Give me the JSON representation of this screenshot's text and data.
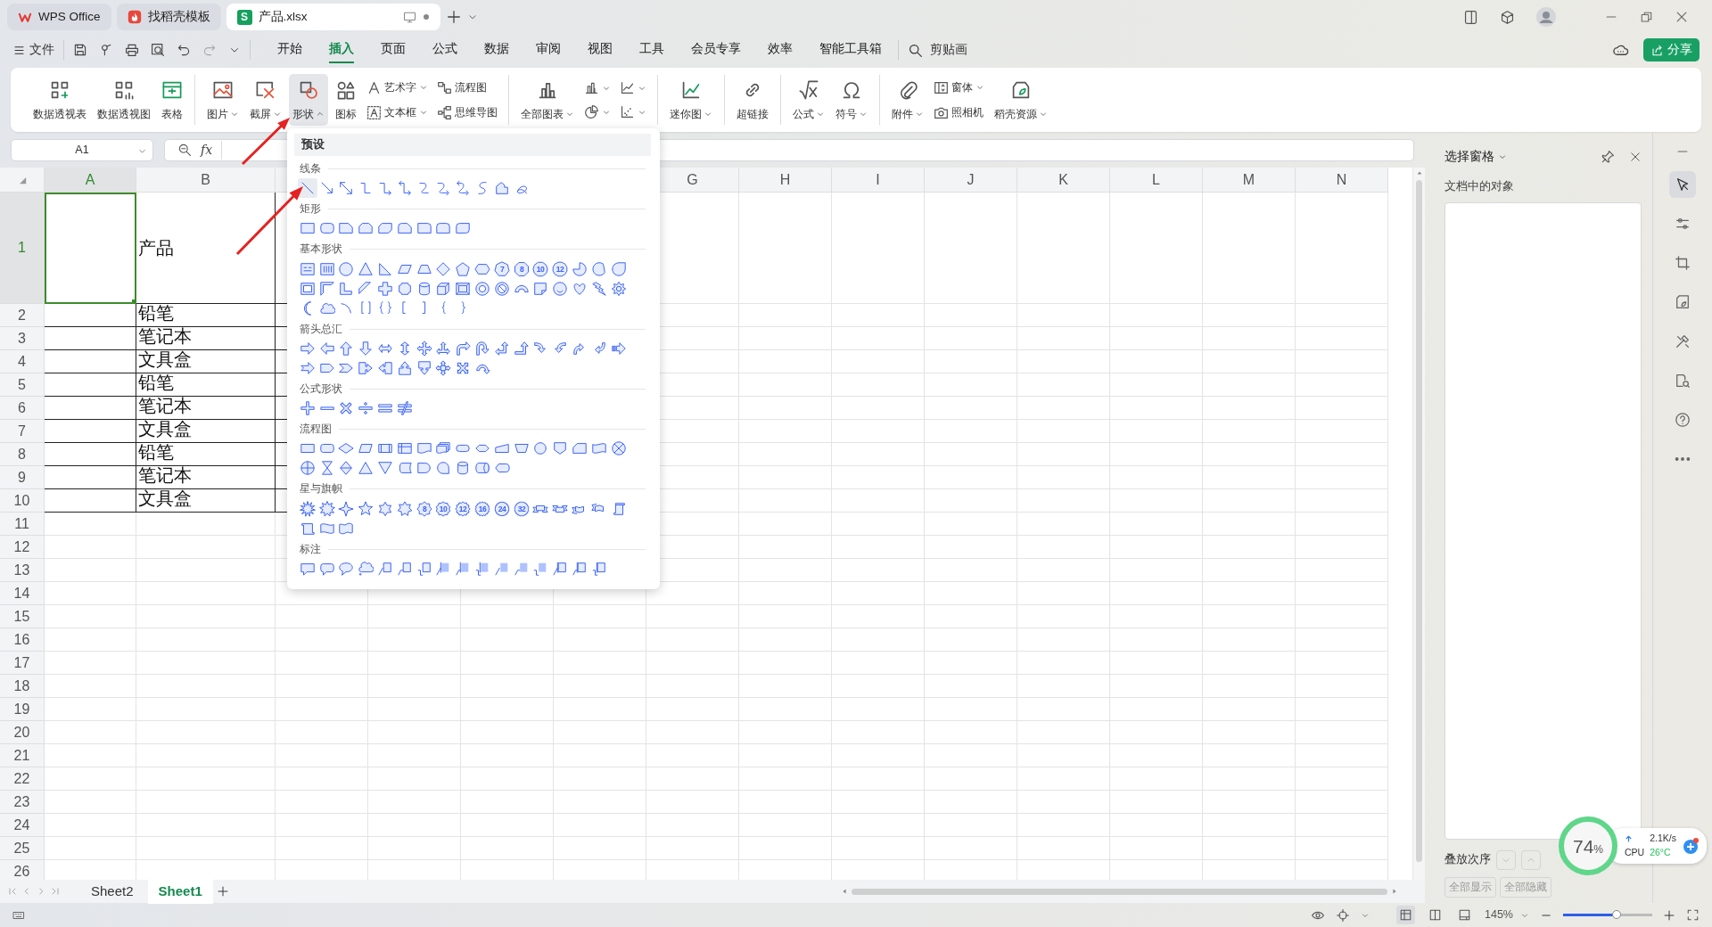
{
  "title_tabs": [
    {
      "kind": "wps",
      "label": "WPS Office",
      "selected": false
    },
    {
      "kind": "docer",
      "label": "找稻壳模板",
      "selected": false
    },
    {
      "kind": "sheet",
      "icon_letter": "S",
      "label": "产品.xlsx",
      "selected": true
    }
  ],
  "menu": {
    "file": "文件",
    "tabs": [
      {
        "label": "开始",
        "selected": false
      },
      {
        "label": "插入",
        "selected": true
      },
      {
        "label": "页面",
        "selected": false
      },
      {
        "label": "公式",
        "selected": false
      },
      {
        "label": "数据",
        "selected": false
      },
      {
        "label": "审阅",
        "selected": false
      },
      {
        "label": "视图",
        "selected": false
      },
      {
        "label": "工具",
        "selected": false
      },
      {
        "label": "会员专享",
        "selected": false
      },
      {
        "label": "效率",
        "selected": false
      },
      {
        "label": "智能工具箱",
        "selected": false
      }
    ],
    "search": "剪贴画",
    "share": "分享"
  },
  "ribbon": [
    {
      "items": [
        {
          "kind": "large",
          "label": "数据透视表",
          "dropdown": false,
          "expanded": false
        },
        {
          "kind": "large",
          "label": "数据透视图",
          "dropdown": false,
          "expanded": false
        },
        {
          "kind": "large",
          "label": "表格",
          "dropdown": false,
          "expanded": false
        }
      ]
    },
    {
      "items": [
        {
          "kind": "large",
          "label": "图片",
          "dropdown": true,
          "expanded": false
        },
        {
          "kind": "large",
          "label": "截屏",
          "dropdown": true,
          "expanded": false
        },
        {
          "kind": "large",
          "label": "形状",
          "dropdown": true,
          "expanded": true
        },
        {
          "kind": "large",
          "label": "图标",
          "dropdown": false,
          "expanded": false
        },
        {
          "kind": "stack",
          "items": [
            {
              "label": "艺术字",
              "dropdown": true,
              "expanded": false
            },
            {
              "label": "文本框",
              "dropdown": true,
              "expanded": false
            }
          ]
        },
        {
          "kind": "stack",
          "items": [
            {
              "label": "流程图",
              "dropdown": false,
              "expanded": false
            },
            {
              "label": "思维导图",
              "dropdown": false,
              "expanded": false
            }
          ]
        }
      ]
    },
    {
      "items": [
        {
          "kind": "large",
          "label": "全部图表",
          "dropdown": true,
          "expanded": false
        },
        {
          "kind": "stack",
          "items": [
            {
              "dropdown": true,
              "expanded": false
            },
            {
              "dropdown": true,
              "expanded": false
            }
          ]
        },
        {
          "kind": "stack",
          "items": [
            {
              "dropdown": true,
              "expanded": false
            },
            {
              "dropdown": true,
              "expanded": false
            }
          ]
        }
      ]
    },
    {
      "items": [
        {
          "kind": "large",
          "label": "迷你图",
          "dropdown": true,
          "expanded": false
        }
      ]
    },
    {
      "items": [
        {
          "kind": "large",
          "label": "超链接",
          "dropdown": false,
          "expanded": false
        }
      ]
    },
    {
      "items": [
        {
          "kind": "large",
          "label": "公式",
          "dropdown": true,
          "expanded": false
        },
        {
          "kind": "large",
          "label": "符号",
          "dropdown": true,
          "expanded": false
        }
      ]
    },
    {
      "items": [
        {
          "kind": "large",
          "label": "附件",
          "dropdown": true,
          "expanded": false
        },
        {
          "kind": "stack",
          "items": [
            {
              "label": "窗体",
              "dropdown": true,
              "expanded": false
            },
            {
              "label": "照相机",
              "dropdown": false,
              "expanded": false
            }
          ]
        },
        {
          "kind": "large",
          "label": "稻壳资源",
          "dropdown": true,
          "expanded": false
        }
      ]
    }
  ],
  "formula_bar": {
    "name_box": "A1",
    "fx": "fx"
  },
  "sheet": {
    "columns": [
      {
        "label": "A",
        "selected": true
      },
      {
        "label": "B",
        "selected": false
      },
      {
        "selected": false
      },
      {},
      {},
      {},
      {
        "label": "G",
        "selected": false
      },
      {
        "label": "H",
        "selected": false
      },
      {
        "label": "I",
        "selected": false
      },
      {
        "label": "J",
        "selected": false
      },
      {
        "label": "K",
        "selected": false
      },
      {
        "label": "L",
        "selected": false
      },
      {
        "label": "M",
        "selected": false
      },
      {
        "label": "N",
        "selected": false
      }
    ],
    "rows": [
      {
        "label": "1",
        "selected": true,
        "bordered": true,
        "b": "产品"
      },
      {
        "label": "2",
        "selected": false,
        "bordered": true,
        "b": "铅笔"
      },
      {
        "label": "3",
        "selected": false,
        "bordered": true,
        "b": "笔记本"
      },
      {
        "label": "4",
        "selected": false,
        "bordered": true,
        "b": "文具盒"
      },
      {
        "label": "5",
        "selected": false,
        "bordered": true,
        "b": "铅笔"
      },
      {
        "label": "6",
        "selected": false,
        "bordered": true,
        "b": "笔记本"
      },
      {
        "label": "7",
        "selected": false,
        "bordered": true,
        "b": "文具盒"
      },
      {
        "label": "8",
        "selected": false,
        "bordered": true,
        "b": "铅笔"
      },
      {
        "label": "9",
        "selected": false,
        "bordered": true,
        "b": "笔记本"
      },
      {
        "label": "10",
        "selected": false,
        "bordered": true,
        "b": "文具盒"
      },
      {
        "label": "11",
        "selected": false,
        "bordered": false
      },
      {
        "label": "12",
        "selected": false,
        "bordered": false
      },
      {
        "label": "13",
        "selected": false,
        "bordered": false
      },
      {
        "label": "14",
        "selected": false,
        "bordered": false
      },
      {
        "label": "15",
        "selected": false,
        "bordered": false
      },
      {
        "label": "16",
        "selected": false,
        "bordered": false
      },
      {
        "label": "17",
        "selected": false,
        "bordered": false
      },
      {
        "label": "18",
        "selected": false,
        "bordered": false
      },
      {
        "label": "19",
        "selected": false,
        "bordered": false
      },
      {
        "label": "20",
        "selected": false,
        "bordered": false
      },
      {
        "label": "21",
        "selected": false,
        "bordered": false
      },
      {
        "label": "22",
        "selected": false,
        "bordered": false
      },
      {
        "label": "23",
        "selected": false,
        "bordered": false
      },
      {
        "label": "24",
        "selected": false,
        "bordered": false
      },
      {
        "label": "25",
        "selected": false,
        "bordered": false
      },
      {
        "label": "26",
        "selected": false,
        "bordered": false
      }
    ]
  },
  "shape_menu": {
    "title": "预设",
    "sections": [
      {
        "title": "线条",
        "items": [
          {
            "kind": "line",
            "selected": true
          },
          {
            "kind": "arrow",
            "selected": false
          },
          {
            "kind": "doublearrow",
            "selected": false
          },
          {
            "kind": "elbow",
            "selected": false
          },
          {
            "kind": "elbowarrow",
            "selected": false
          },
          {
            "kind": "elbowdouble",
            "selected": false
          },
          {
            "kind": "curve",
            "selected": false
          },
          {
            "kind": "curvearrow",
            "selected": false
          },
          {
            "kind": "curvedouble",
            "selected": false
          },
          {
            "kind": "scurve",
            "selected": false
          },
          {
            "kind": "freeform",
            "selected": false
          },
          {
            "kind": "scribble",
            "selected": false
          }
        ]
      },
      {
        "title": "矩形",
        "items": [
          {
            "kind": "rect",
            "selected": false
          },
          {
            "kind": "roundrect",
            "selected": false
          },
          {
            "kind": "snip1",
            "selected": false
          },
          {
            "kind": "snip2",
            "selected": false
          },
          {
            "kind": "snipdiag",
            "selected": false
          },
          {
            "kind": "sniproundrect",
            "selected": false
          },
          {
            "kind": "round1",
            "selected": false
          },
          {
            "kind": "round2",
            "selected": false
          },
          {
            "kind": "rounddiag",
            "selected": false
          }
        ]
      },
      {
        "title": "基本形状",
        "items": [
          {
            "kind": "textbox",
            "selected": false
          },
          {
            "kind": "vtextbox",
            "selected": false
          },
          {
            "kind": "ellipse",
            "selected": false
          },
          {
            "kind": "triangle",
            "selected": false
          },
          {
            "kind": "righttriangle",
            "selected": false
          },
          {
            "kind": "parallelogram",
            "selected": false
          },
          {
            "kind": "trapezoid",
            "selected": false
          },
          {
            "kind": "diamond",
            "selected": false
          },
          {
            "kind": "pentagon",
            "selected": false
          },
          {
            "kind": "hexagon",
            "selected": false
          },
          {
            "kind": "heptagon",
            "label": "7",
            "selected": false
          },
          {
            "kind": "octagon",
            "label": "8",
            "selected": false
          },
          {
            "kind": "decagon",
            "label": "10",
            "selected": false
          },
          {
            "kind": "dodecagon",
            "label": "12",
            "selected": false
          },
          {
            "kind": "pie",
            "selected": false
          },
          {
            "kind": "chord",
            "selected": false
          },
          {
            "kind": "teardrop",
            "selected": false
          },
          {
            "kind": "frame",
            "selected": false
          },
          {
            "kind": "halfframe",
            "selected": false
          },
          {
            "kind": "lshape",
            "selected": false
          },
          {
            "kind": "diagstripe",
            "selected": false
          },
          {
            "kind": "cross",
            "selected": false
          },
          {
            "kind": "plaque",
            "selected": false
          },
          {
            "kind": "can",
            "selected": false
          },
          {
            "kind": "cube",
            "selected": false
          },
          {
            "kind": "bevel",
            "selected": false
          },
          {
            "kind": "donut",
            "selected": false
          },
          {
            "kind": "nosymbol",
            "selected": false
          },
          {
            "kind": "blockarc",
            "selected": false
          },
          {
            "kind": "folded",
            "selected": false
          },
          {
            "kind": "smiley",
            "selected": false
          },
          {
            "kind": "heart",
            "selected": false
          },
          {
            "kind": "lightning",
            "selected": false
          },
          {
            "kind": "sun",
            "selected": false
          },
          {
            "kind": "moon",
            "selected": false
          },
          {
            "kind": "cloud",
            "selected": false
          },
          {
            "kind": "arc",
            "selected": false
          },
          {
            "kind": "dbracket",
            "selected": false
          },
          {
            "kind": "dbrace",
            "selected": false
          },
          {
            "kind": "lbracket",
            "selected": false
          },
          {
            "kind": "rbracket",
            "selected": false
          },
          {
            "kind": "lbrace",
            "selected": false
          },
          {
            "kind": "rbrace",
            "selected": false
          }
        ]
      },
      {
        "title": "箭头总汇",
        "items": [
          {
            "kind": "rightarrow",
            "selected": false
          },
          {
            "kind": "leftarrow",
            "selected": false
          },
          {
            "kind": "uparrow",
            "selected": false
          },
          {
            "kind": "downarrow",
            "selected": false
          },
          {
            "kind": "leftright",
            "selected": false
          },
          {
            "kind": "updown",
            "selected": false
          },
          {
            "kind": "quad",
            "selected": false
          },
          {
            "kind": "leftrightup",
            "selected": false
          },
          {
            "kind": "bent",
            "selected": false
          },
          {
            "kind": "uturn",
            "selected": false
          },
          {
            "kind": "leftup",
            "selected": false
          },
          {
            "kind": "bentup",
            "selected": false
          },
          {
            "kind": "curvedright",
            "selected": false
          },
          {
            "kind": "curvedleft",
            "selected": false
          },
          {
            "kind": "curvedup",
            "selected": false
          },
          {
            "kind": "curveddown",
            "selected": false
          },
          {
            "kind": "striped",
            "selected": false
          },
          {
            "kind": "notched",
            "selected": false
          },
          {
            "kind": "pentagonarrow",
            "selected": false
          },
          {
            "kind": "chevron",
            "selected": false
          },
          {
            "kind": "rightcallout",
            "selected": false
          },
          {
            "kind": "leftcallout",
            "selected": false
          },
          {
            "kind": "upcallout",
            "selected": false
          },
          {
            "kind": "downcallout",
            "selected": false
          },
          {
            "kind": "crosscallout",
            "selected": false
          },
          {
            "kind": "quadcallout",
            "selected": false
          },
          {
            "kind": "circular",
            "selected": false
          }
        ]
      },
      {
        "title": "公式形状",
        "items": [
          {
            "kind": "plus",
            "selected": false
          },
          {
            "kind": "minus",
            "selected": false
          },
          {
            "kind": "multiply",
            "selected": false
          },
          {
            "kind": "divide",
            "selected": false
          },
          {
            "kind": "equal",
            "selected": false
          },
          {
            "kind": "notequal",
            "selected": false
          }
        ]
      },
      {
        "title": "流程图",
        "items": [
          {
            "kind": "process",
            "selected": false
          },
          {
            "kind": "altprocess",
            "selected": false
          },
          {
            "kind": "decision",
            "selected": false
          },
          {
            "kind": "data",
            "selected": false
          },
          {
            "kind": "predefined",
            "selected": false
          },
          {
            "kind": "internal",
            "selected": false
          },
          {
            "kind": "document",
            "selected": false
          },
          {
            "kind": "multidoc",
            "selected": false
          },
          {
            "kind": "terminator",
            "selected": false
          },
          {
            "kind": "preparation",
            "selected": false
          },
          {
            "kind": "manualinput",
            "selected": false
          },
          {
            "kind": "manualop",
            "selected": false
          },
          {
            "kind": "connector",
            "selected": false
          },
          {
            "kind": "offpage",
            "selected": false
          },
          {
            "kind": "card",
            "selected": false
          },
          {
            "kind": "punchedtape",
            "selected": false
          },
          {
            "kind": "summing",
            "selected": false
          },
          {
            "kind": "or",
            "selected": false
          },
          {
            "kind": "collate",
            "selected": false
          },
          {
            "kind": "sort",
            "selected": false
          },
          {
            "kind": "extract",
            "selected": false
          },
          {
            "kind": "merge",
            "selected": false
          },
          {
            "kind": "storeddata",
            "selected": false
          },
          {
            "kind": "delay",
            "selected": false
          },
          {
            "kind": "seqaccess",
            "selected": false
          },
          {
            "kind": "magdisk",
            "selected": false
          },
          {
            "kind": "directaccess",
            "selected": false
          },
          {
            "kind": "display",
            "selected": false
          }
        ]
      },
      {
        "title": "星与旗帜",
        "items": [
          {
            "kind": "explosion1",
            "selected": false
          },
          {
            "kind": "explosion2",
            "selected": false
          },
          {
            "kind": "star4",
            "selected": false
          },
          {
            "kind": "star5",
            "selected": false
          },
          {
            "kind": "star6",
            "selected": false
          },
          {
            "kind": "star7",
            "selected": false
          },
          {
            "kind": "star8",
            "label": "8",
            "selected": false
          },
          {
            "kind": "star10",
            "label": "10",
            "selected": false
          },
          {
            "kind": "star12",
            "label": "12",
            "selected": false
          },
          {
            "kind": "star16",
            "label": "16",
            "selected": false
          },
          {
            "kind": "star24",
            "label": "24",
            "selected": false
          },
          {
            "kind": "star32",
            "label": "32",
            "selected": false
          },
          {
            "kind": "ribbondown",
            "selected": false
          },
          {
            "kind": "ribbonup",
            "selected": false
          },
          {
            "kind": "curvedribbondown",
            "selected": false
          },
          {
            "kind": "curvedribbonup",
            "selected": false
          },
          {
            "kind": "verticalscroll",
            "selected": false
          },
          {
            "kind": "horizontalscroll",
            "selected": false
          },
          {
            "kind": "wave",
            "selected": false
          },
          {
            "kind": "doublewave",
            "selected": false
          }
        ]
      },
      {
        "title": "标注",
        "items": [
          {
            "kind": "rectcallout",
            "selected": false
          },
          {
            "kind": "roundcallout",
            "selected": false
          },
          {
            "kind": "ovalcallout",
            "selected": false
          },
          {
            "kind": "cloudcallout",
            "selected": false
          },
          {
            "kind": "linecallout1",
            "selected": false
          },
          {
            "kind": "linecallout2",
            "selected": false
          },
          {
            "kind": "linecallout3",
            "selected": false
          },
          {
            "kind": "accentbordercallout1",
            "selected": false
          },
          {
            "kind": "accentbordercallout2",
            "selected": false
          },
          {
            "kind": "accentbordercallout3",
            "selected": false
          },
          {
            "kind": "bordercallout1",
            "selected": false
          },
          {
            "kind": "bordercallout2",
            "selected": false
          },
          {
            "kind": "bordercallout3",
            "selected": false
          },
          {
            "kind": "accentcallout1",
            "selected": false
          },
          {
            "kind": "accentcallout2",
            "selected": false
          },
          {
            "kind": "accentcallout3",
            "selected": false
          }
        ]
      }
    ]
  },
  "selection_pane": {
    "title": "选择窗格",
    "subtitle": "文档中的对象",
    "order_label": "叠放次序",
    "order_buttons": [
      {
        "disabled": true
      },
      {
        "disabled": true
      }
    ],
    "buttons": [
      {
        "label": "全部显示",
        "disabled": true
      },
      {
        "label": "全部隐藏",
        "disabled": true
      }
    ]
  },
  "side_tools": [
    {
      "selected": true
    },
    {
      "selected": false
    },
    {
      "selected": false
    },
    {
      "selected": false
    },
    {
      "selected": false
    },
    {
      "selected": false
    },
    {
      "selected": false
    },
    {
      "selected": false
    }
  ],
  "sheet_tabs": [
    {
      "label": "Sheet2",
      "selected": false
    },
    {
      "label": "Sheet1",
      "selected": true
    }
  ],
  "status": {
    "zoom": "145%",
    "zoom_slider": {
      "level": 0.6
    }
  },
  "cpu_widget": {
    "percent": "74",
    "unit": "%",
    "speed": "2.1K/s",
    "label": "CPU",
    "temperature": "26°C"
  }
}
